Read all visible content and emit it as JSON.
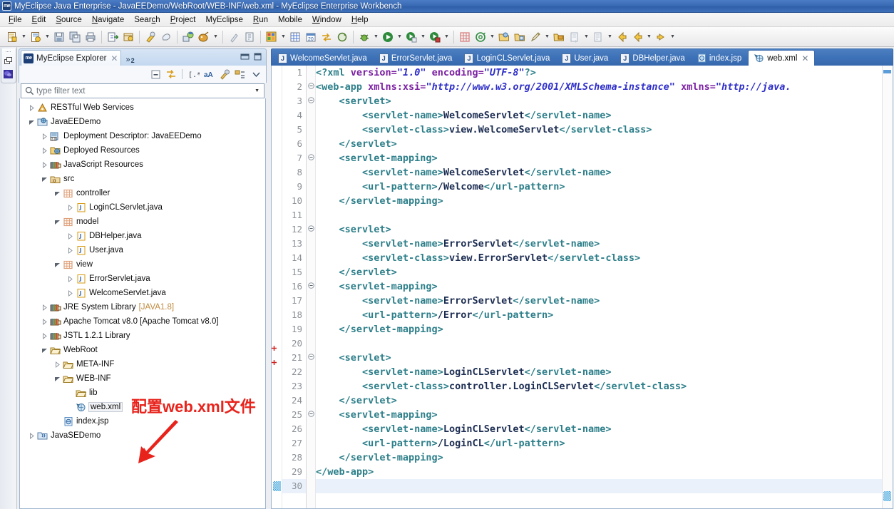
{
  "window": {
    "title": "MyEclipse Java Enterprise - JavaEEDemo/WebRoot/WEB-INF/web.xml - MyEclipse Enterprise Workbench",
    "app_icon": "me"
  },
  "menubar": {
    "items": [
      {
        "label": "File",
        "mnemonic": "F"
      },
      {
        "label": "Edit",
        "mnemonic": "E"
      },
      {
        "label": "Source",
        "mnemonic": "S"
      },
      {
        "label": "Navigate",
        "mnemonic": "N"
      },
      {
        "label": "Search",
        "mnemonic": "c"
      },
      {
        "label": "Project",
        "mnemonic": "P"
      },
      {
        "label": "MyEclipse",
        "mnemonic": ""
      },
      {
        "label": "Run",
        "mnemonic": "R"
      },
      {
        "label": "Mobile",
        "mnemonic": ""
      },
      {
        "label": "Window",
        "mnemonic": "W"
      },
      {
        "label": "Help",
        "mnemonic": "H"
      }
    ]
  },
  "toolbar": {
    "buttons": [
      {
        "icon": "new-file-icon",
        "dropdown": true
      },
      {
        "icon": "new-wizard-icon",
        "dropdown": true
      },
      {
        "icon": "save-icon",
        "dropdown": false
      },
      {
        "icon": "save-all-icon",
        "dropdown": false
      },
      {
        "icon": "print-icon",
        "dropdown": false
      },
      {
        "icon": "separator",
        "dropdown": false
      },
      {
        "icon": "export-icon",
        "dropdown": false
      },
      {
        "icon": "package-icon",
        "dropdown": false
      },
      {
        "icon": "separator",
        "dropdown": false
      },
      {
        "icon": "build-icon",
        "dropdown": false
      },
      {
        "icon": "clean-icon",
        "dropdown": false
      },
      {
        "icon": "separator",
        "dropdown": false
      },
      {
        "icon": "deploy-icon",
        "dropdown": false
      },
      {
        "icon": "server-icon",
        "dropdown": true
      },
      {
        "icon": "separator",
        "dropdown": false
      },
      {
        "icon": "quick-fix-icon",
        "dropdown": false
      },
      {
        "icon": "open-type-icon",
        "dropdown": false
      },
      {
        "icon": "separator",
        "dropdown": false
      },
      {
        "icon": "database-explorer-icon",
        "dropdown": true
      },
      {
        "icon": "table-icon",
        "dropdown": false
      },
      {
        "icon": "calendar-icon",
        "dropdown": false
      },
      {
        "icon": "sync-icon",
        "dropdown": false
      },
      {
        "icon": "refresh-icon",
        "dropdown": false
      },
      {
        "icon": "separator",
        "dropdown": false
      },
      {
        "icon": "debug-icon",
        "dropdown": true
      },
      {
        "icon": "run-icon",
        "dropdown": true
      },
      {
        "icon": "run-config-icon",
        "dropdown": true
      },
      {
        "icon": "run-lock-icon",
        "dropdown": true
      },
      {
        "icon": "separator",
        "dropdown": false
      },
      {
        "icon": "new-class-icon",
        "dropdown": false
      },
      {
        "icon": "new-annotation-icon",
        "dropdown": true
      },
      {
        "icon": "open-folder-icon",
        "dropdown": false
      },
      {
        "icon": "open-resource-icon",
        "dropdown": false
      },
      {
        "icon": "search-pencil-icon",
        "dropdown": true
      },
      {
        "icon": "open-package-icon",
        "dropdown": false
      },
      {
        "icon": "next-annotation-icon",
        "dropdown": true
      },
      {
        "icon": "previous-marker-icon",
        "dropdown": true
      },
      {
        "icon": "back-icon",
        "dropdown": false
      },
      {
        "icon": "back-history-icon",
        "dropdown": true
      },
      {
        "icon": "forward-icon",
        "dropdown": true
      }
    ]
  },
  "fastview": {
    "icons": [
      "restore-perspective-icon",
      "myeclipse-perspective-icon"
    ]
  },
  "explorer": {
    "tab_label": "MyEclipse Explorer",
    "tab_icon": "me",
    "overflow_count": "2",
    "window_buttons": [
      "minimize-icon",
      "maximize-icon"
    ],
    "view_toolbar": [
      "collapse-all-icon",
      "link-with-editor-icon",
      "filter-icon",
      "sort-icon",
      "build-icon",
      "package-presentation-icon",
      "view-menu-icon"
    ],
    "filter": {
      "placeholder": "type filter text",
      "value": "",
      "icon": "search-icon"
    },
    "tree": [
      {
        "indent": 0,
        "twist": "collapsed",
        "icon": "restful-icon",
        "label": "RESTful Web Services",
        "sub": ""
      },
      {
        "indent": 0,
        "twist": "expanded",
        "icon": "project-web-icon",
        "label": "JavaEEDemo",
        "sub": ""
      },
      {
        "indent": 1,
        "twist": "collapsed",
        "icon": "descriptor-icon",
        "label": "Deployment Descriptor: JavaEEDemo",
        "sub": ""
      },
      {
        "indent": 1,
        "twist": "collapsed",
        "icon": "deployed-res-icon",
        "label": "Deployed Resources",
        "sub": ""
      },
      {
        "indent": 1,
        "twist": "collapsed",
        "icon": "library-icon",
        "label": "JavaScript Resources",
        "sub": ""
      },
      {
        "indent": 1,
        "twist": "expanded",
        "icon": "source-folder-icon",
        "label": "src",
        "sub": ""
      },
      {
        "indent": 2,
        "twist": "expanded",
        "icon": "package-icon",
        "label": "controller",
        "sub": ""
      },
      {
        "indent": 3,
        "twist": "collapsed",
        "icon": "java-file-icon",
        "label": "LoginCLServlet.java",
        "sub": ""
      },
      {
        "indent": 2,
        "twist": "expanded",
        "icon": "package-icon",
        "label": "model",
        "sub": ""
      },
      {
        "indent": 3,
        "twist": "collapsed",
        "icon": "java-file-icon",
        "label": "DBHelper.java",
        "sub": ""
      },
      {
        "indent": 3,
        "twist": "collapsed",
        "icon": "java-file-icon",
        "label": "User.java",
        "sub": ""
      },
      {
        "indent": 2,
        "twist": "expanded",
        "icon": "package-icon",
        "label": "view",
        "sub": ""
      },
      {
        "indent": 3,
        "twist": "collapsed",
        "icon": "java-file-icon",
        "label": "ErrorServlet.java",
        "sub": ""
      },
      {
        "indent": 3,
        "twist": "collapsed",
        "icon": "java-file-icon",
        "label": "WelcomeServlet.java",
        "sub": ""
      },
      {
        "indent": 1,
        "twist": "collapsed",
        "icon": "library-icon",
        "label": "JRE System Library",
        "sub": "[JAVA1.8]"
      },
      {
        "indent": 1,
        "twist": "collapsed",
        "icon": "library-icon",
        "label": "Apache Tomcat v8.0 [Apache Tomcat v8.0]",
        "sub": ""
      },
      {
        "indent": 1,
        "twist": "collapsed",
        "icon": "library-icon",
        "label": "JSTL 1.2.1 Library",
        "sub": ""
      },
      {
        "indent": 1,
        "twist": "expanded",
        "icon": "folder-icon",
        "label": "WebRoot",
        "sub": ""
      },
      {
        "indent": 2,
        "twist": "collapsed",
        "icon": "folder-icon",
        "label": "META-INF",
        "sub": ""
      },
      {
        "indent": 2,
        "twist": "expanded",
        "icon": "folder-icon",
        "label": "WEB-INF",
        "sub": ""
      },
      {
        "indent": 3,
        "twist": "none",
        "icon": "folder-icon",
        "label": "lib",
        "sub": ""
      },
      {
        "indent": 3,
        "twist": "none",
        "icon": "xml-file-icon",
        "label": "web.xml",
        "sub": "",
        "selected": true
      },
      {
        "indent": 2,
        "twist": "none",
        "icon": "jsp-file-icon",
        "label": "index.jsp",
        "sub": ""
      },
      {
        "indent": 0,
        "twist": "collapsed",
        "icon": "project-java-icon",
        "label": "JavaSEDemo",
        "sub": ""
      }
    ]
  },
  "annotation": {
    "text": "配置web.xml文件",
    "color": "#e8231c",
    "arrow": "red-arrow-pointing-down-left"
  },
  "editor": {
    "tabs": [
      {
        "label": "WelcomeServlet.java",
        "icon": "java-file-icon",
        "active": false,
        "closable": false
      },
      {
        "label": "ErrorServlet.java",
        "icon": "java-file-icon",
        "active": false,
        "closable": false
      },
      {
        "label": "LoginCLServlet.java",
        "icon": "java-file-icon",
        "active": false,
        "closable": false
      },
      {
        "label": "User.java",
        "icon": "java-file-icon",
        "active": false,
        "closable": false
      },
      {
        "label": "DBHelper.java",
        "icon": "java-file-icon",
        "active": false,
        "closable": false
      },
      {
        "label": "index.jsp",
        "icon": "jsp-file-icon",
        "active": false,
        "closable": false
      },
      {
        "label": "web.xml",
        "icon": "xml-file-icon",
        "active": true,
        "closable": true
      }
    ],
    "current_line": 30,
    "total_lines": 30,
    "lines": [
      {
        "n": 1,
        "fold": "",
        "marker": "",
        "tokens": [
          {
            "t": "pi",
            "v": "<?xml "
          },
          {
            "t": "attr",
            "v": "version="
          },
          {
            "t": "val",
            "v": "\"1.0\""
          },
          {
            "t": "pi",
            "v": " "
          },
          {
            "t": "attr",
            "v": "encoding="
          },
          {
            "t": "val",
            "v": "\"UTF-8\""
          },
          {
            "t": "pi",
            "v": "?>"
          }
        ]
      },
      {
        "n": 2,
        "fold": "-",
        "marker": "",
        "tokens": [
          {
            "t": "tg",
            "v": "<web-app "
          },
          {
            "t": "attr",
            "v": "xmlns:xsi="
          },
          {
            "t": "val",
            "v": "\"http://www.w3.org/2001/XMLSchema-instance\""
          },
          {
            "t": "tg",
            "v": " "
          },
          {
            "t": "attr",
            "v": "xmlns="
          },
          {
            "t": "val",
            "v": "\"http://java."
          }
        ]
      },
      {
        "n": 3,
        "fold": "-",
        "marker": "",
        "tokens": [
          {
            "t": "tg",
            "v": "    <servlet>"
          }
        ]
      },
      {
        "n": 4,
        "fold": "",
        "marker": "",
        "tokens": [
          {
            "t": "tg",
            "v": "        <servlet-name>"
          },
          {
            "t": "txt",
            "v": "WelcomeServlet"
          },
          {
            "t": "tg",
            "v": "</servlet-name>"
          }
        ]
      },
      {
        "n": 5,
        "fold": "",
        "marker": "",
        "tokens": [
          {
            "t": "tg",
            "v": "        <servlet-class>"
          },
          {
            "t": "txt",
            "v": "view.WelcomeServlet"
          },
          {
            "t": "tg",
            "v": "</servlet-class>"
          }
        ]
      },
      {
        "n": 6,
        "fold": "",
        "marker": "",
        "tokens": [
          {
            "t": "tg",
            "v": "    </servlet>"
          }
        ]
      },
      {
        "n": 7,
        "fold": "-",
        "marker": "",
        "tokens": [
          {
            "t": "tg",
            "v": "    <servlet-mapping>"
          }
        ]
      },
      {
        "n": 8,
        "fold": "",
        "marker": "",
        "tokens": [
          {
            "t": "tg",
            "v": "        <servlet-name>"
          },
          {
            "t": "txt",
            "v": "WelcomeServlet"
          },
          {
            "t": "tg",
            "v": "</servlet-name>"
          }
        ]
      },
      {
        "n": 9,
        "fold": "",
        "marker": "",
        "tokens": [
          {
            "t": "tg",
            "v": "        <url-pattern>"
          },
          {
            "t": "txt",
            "v": "/Welcome"
          },
          {
            "t": "tg",
            "v": "</url-pattern>"
          }
        ]
      },
      {
        "n": 10,
        "fold": "",
        "marker": "",
        "tokens": [
          {
            "t": "tg",
            "v": "    </servlet-mapping>"
          }
        ]
      },
      {
        "n": 11,
        "fold": "",
        "marker": "",
        "tokens": [
          {
            "t": "tg",
            "v": ""
          }
        ]
      },
      {
        "n": 12,
        "fold": "-",
        "marker": "",
        "tokens": [
          {
            "t": "tg",
            "v": "    <servlet>"
          }
        ]
      },
      {
        "n": 13,
        "fold": "",
        "marker": "",
        "tokens": [
          {
            "t": "tg",
            "v": "        <servlet-name>"
          },
          {
            "t": "txt",
            "v": "ErrorServlet"
          },
          {
            "t": "tg",
            "v": "</servlet-name>"
          }
        ]
      },
      {
        "n": 14,
        "fold": "",
        "marker": "",
        "tokens": [
          {
            "t": "tg",
            "v": "        <servlet-class>"
          },
          {
            "t": "txt",
            "v": "view.ErrorServlet"
          },
          {
            "t": "tg",
            "v": "</servlet-class>"
          }
        ]
      },
      {
        "n": 15,
        "fold": "",
        "marker": "",
        "tokens": [
          {
            "t": "tg",
            "v": "    </servlet>"
          }
        ]
      },
      {
        "n": 16,
        "fold": "-",
        "marker": "",
        "tokens": [
          {
            "t": "tg",
            "v": "    <servlet-mapping>"
          }
        ]
      },
      {
        "n": 17,
        "fold": "",
        "marker": "",
        "tokens": [
          {
            "t": "tg",
            "v": "        <servlet-name>"
          },
          {
            "t": "txt",
            "v": "ErrorServlet"
          },
          {
            "t": "tg",
            "v": "</servlet-name>"
          }
        ]
      },
      {
        "n": 18,
        "fold": "",
        "marker": "",
        "tokens": [
          {
            "t": "tg",
            "v": "        <url-pattern>"
          },
          {
            "t": "txt",
            "v": "/Error"
          },
          {
            "t": "tg",
            "v": "</url-pattern>"
          }
        ]
      },
      {
        "n": 19,
        "fold": "",
        "marker": "",
        "tokens": [
          {
            "t": "tg",
            "v": "    </servlet-mapping>"
          }
        ]
      },
      {
        "n": 20,
        "fold": "",
        "marker": "error",
        "tokens": [
          {
            "t": "tg",
            "v": ""
          }
        ]
      },
      {
        "n": 21,
        "fold": "-",
        "marker": "error",
        "tokens": [
          {
            "t": "tg",
            "v": "    <servlet>"
          }
        ]
      },
      {
        "n": 22,
        "fold": "",
        "marker": "",
        "tokens": [
          {
            "t": "tg",
            "v": "        <servlet-name>"
          },
          {
            "t": "txt",
            "v": "LoginCLServlet"
          },
          {
            "t": "tg",
            "v": "</servlet-name>"
          }
        ]
      },
      {
        "n": 23,
        "fold": "",
        "marker": "",
        "tokens": [
          {
            "t": "tg",
            "v": "        <servlet-class>"
          },
          {
            "t": "txt",
            "v": "controller.LoginCLServlet"
          },
          {
            "t": "tg",
            "v": "</servlet-class>"
          }
        ]
      },
      {
        "n": 24,
        "fold": "",
        "marker": "",
        "tokens": [
          {
            "t": "tg",
            "v": "    </servlet>"
          }
        ]
      },
      {
        "n": 25,
        "fold": "-",
        "marker": "",
        "tokens": [
          {
            "t": "tg",
            "v": "    <servlet-mapping>"
          }
        ]
      },
      {
        "n": 26,
        "fold": "",
        "marker": "",
        "tokens": [
          {
            "t": "tg",
            "v": "        <servlet-name>"
          },
          {
            "t": "txt",
            "v": "LoginCLServlet"
          },
          {
            "t": "tg",
            "v": "</servlet-name>"
          }
        ]
      },
      {
        "n": 27,
        "fold": "",
        "marker": "",
        "tokens": [
          {
            "t": "tg",
            "v": "        <url-pattern>"
          },
          {
            "t": "txt",
            "v": "/LoginCL"
          },
          {
            "t": "tg",
            "v": "</url-pattern>"
          }
        ]
      },
      {
        "n": 28,
        "fold": "",
        "marker": "",
        "tokens": [
          {
            "t": "tg",
            "v": "    </servlet-mapping>"
          }
        ]
      },
      {
        "n": 29,
        "fold": "",
        "marker": "",
        "tokens": [
          {
            "t": "tg",
            "v": "</web-app>"
          }
        ]
      },
      {
        "n": 30,
        "fold": "",
        "marker": "caret",
        "tokens": [
          {
            "t": "tg",
            "v": ""
          }
        ]
      }
    ]
  }
}
